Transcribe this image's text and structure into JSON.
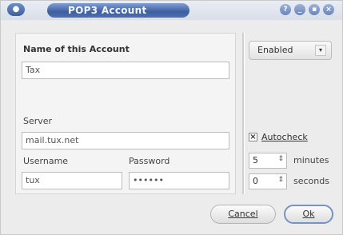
{
  "window": {
    "title": "POP3 Account",
    "controls": [
      "?",
      "_",
      "▪",
      "×"
    ]
  },
  "form": {
    "account_name_label": "Name of this Account",
    "account_name_value": "Tax",
    "server_label": "Server",
    "server_value": "mail.tux.net",
    "username_label": "Username",
    "username_value": "tux",
    "password_label": "Password",
    "password_value": "••••••"
  },
  "side": {
    "status_selected": "Enabled",
    "autocheck_label": "Autocheck",
    "autocheck_checked": true,
    "minutes_value": "5",
    "minutes_label": "minutes",
    "seconds_value": "0",
    "seconds_label": "seconds"
  },
  "buttons": {
    "cancel": "Cancel",
    "ok": "Ok"
  }
}
